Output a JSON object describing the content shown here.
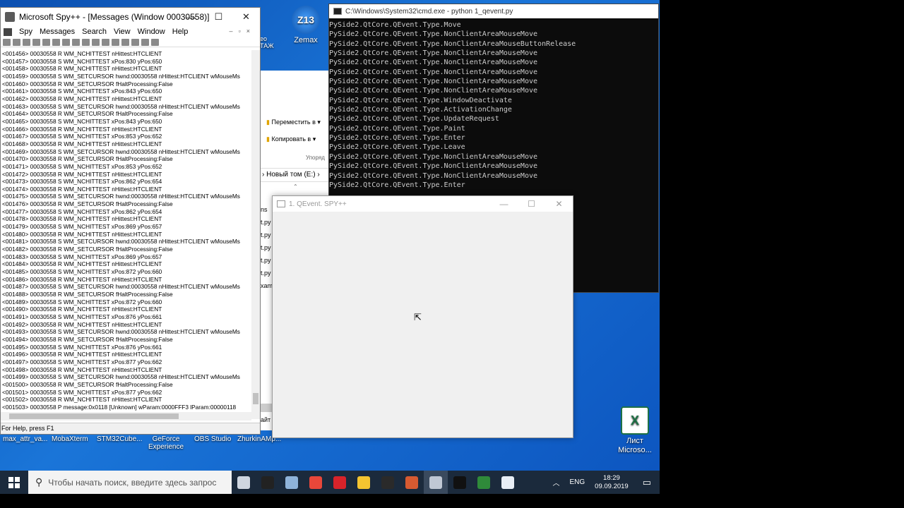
{
  "desktop": {
    "icons": [
      {
        "label": "Zemax",
        "badge": "Z13"
      },
      {
        "label": "Лист\nMicroso...",
        "badge": "X"
      }
    ],
    "bottom_icons": [
      "max_attr_va...",
      "MobaXterm",
      "STM32Cube...",
      "GeForce\nExperience",
      "OBS Studio",
      "ZhurkinAMp..."
    ],
    "left_partial_labels": [
      "eo",
      "ТАЖ"
    ]
  },
  "spy": {
    "title": "Microsoft Spy++ - [Messages (Window 00030558)]",
    "menu": [
      "Spy",
      "Messages",
      "Search",
      "View",
      "Window",
      "Help"
    ],
    "status": "For Help, press F1",
    "log": [
      "<001456> 00030558 R WM_NCHITTEST nHittest:HTCLIENT",
      "<001457> 00030558 S WM_NCHITTEST xPos:830 yPos:650",
      "<001458> 00030558 R WM_NCHITTEST nHittest:HTCLIENT",
      "<001459> 00030558 S WM_SETCURSOR hwnd:00030558 nHittest:HTCLIENT wMouseMs",
      "<001460> 00030558 R WM_SETCURSOR fHaltProcessing:False",
      "<001461> 00030558 S WM_NCHITTEST xPos:843 yPos:650",
      "<001462> 00030558 R WM_NCHITTEST nHittest:HTCLIENT",
      "<001463> 00030558 S WM_SETCURSOR hwnd:00030558 nHittest:HTCLIENT wMouseMs",
      "<001464> 00030558 R WM_SETCURSOR fHaltProcessing:False",
      "<001465> 00030558 S WM_NCHITTEST xPos:843 yPos:650",
      "<001466> 00030558 R WM_NCHITTEST nHittest:HTCLIENT",
      "<001467> 00030558 S WM_NCHITTEST xPos:853 yPos:652",
      "<001468> 00030558 R WM_NCHITTEST nHittest:HTCLIENT",
      "<001469> 00030558 S WM_SETCURSOR hwnd:00030558 nHittest:HTCLIENT wMouseMs",
      "<001470> 00030558 R WM_SETCURSOR fHaltProcessing:False",
      "<001471> 00030558 S WM_NCHITTEST xPos:853 yPos:652",
      "<001472> 00030558 R WM_NCHITTEST nHittest:HTCLIENT",
      "<001473> 00030558 S WM_NCHITTEST xPos:862 yPos:654",
      "<001474> 00030558 R WM_NCHITTEST nHittest:HTCLIENT",
      "<001475> 00030558 S WM_SETCURSOR hwnd:00030558 nHittest:HTCLIENT wMouseMs",
      "<001476> 00030558 R WM_SETCURSOR fHaltProcessing:False",
      "<001477> 00030558 S WM_NCHITTEST xPos:862 yPos:654",
      "<001478> 00030558 R WM_NCHITTEST nHittest:HTCLIENT",
      "<001479> 00030558 S WM_NCHITTEST xPos:869 yPos:657",
      "<001480> 00030558 R WM_NCHITTEST nHittest:HTCLIENT",
      "<001481> 00030558 S WM_SETCURSOR hwnd:00030558 nHittest:HTCLIENT wMouseMs",
      "<001482> 00030558 R WM_SETCURSOR fHaltProcessing:False",
      "<001483> 00030558 S WM_NCHITTEST xPos:869 yPos:657",
      "<001484> 00030558 R WM_NCHITTEST nHittest:HTCLIENT",
      "<001485> 00030558 S WM_NCHITTEST xPos:872 yPos:660",
      "<001486> 00030558 R WM_NCHITTEST nHittest:HTCLIENT",
      "<001487> 00030558 S WM_SETCURSOR hwnd:00030558 nHittest:HTCLIENT wMouseMs",
      "<001488> 00030558 R WM_SETCURSOR fHaltProcessing:False",
      "<001489> 00030558 S WM_NCHITTEST xPos:872 yPos:660",
      "<001490> 00030558 R WM_NCHITTEST nHittest:HTCLIENT",
      "<001491> 00030558 S WM_NCHITTEST xPos:876 yPos:661",
      "<001492> 00030558 R WM_NCHITTEST nHittest:HTCLIENT",
      "<001493> 00030558 S WM_SETCURSOR hwnd:00030558 nHittest:HTCLIENT wMouseMs",
      "<001494> 00030558 R WM_SETCURSOR fHaltProcessing:False",
      "<001495> 00030558 S WM_NCHITTEST xPos:876 yPos:661",
      "<001496> 00030558 R WM_NCHITTEST nHittest:HTCLIENT",
      "<001497> 00030558 S WM_NCHITTEST xPos:877 yPos:662",
      "<001498> 00030558 R WM_NCHITTEST nHittest:HTCLIENT",
      "<001499> 00030558 S WM_SETCURSOR hwnd:00030558 nHittest:HTCLIENT wMouseMs",
      "<001500> 00030558 R WM_SETCURSOR fHaltProcessing:False",
      "<001501> 00030558 S WM_NCHITTEST xPos:877 yPos:662",
      "<001502> 00030558 R WM_NCHITTEST nHittest:HTCLIENT",
      "<001503> 00030558 P message:0x0118 [Unknown] wParam:0000FFF3 lParam:00000118"
    ]
  },
  "explorer": {
    "move_label": "Переместить в",
    "copy_label": "Копировать в",
    "organize_label": "Упоряд",
    "breadcrumb": "Новый том (E:)",
    "file_fragments": [
      "ns",
      "t.py",
      "t.py",
      "t.py",
      "t.py",
      "t.py",
      "xam"
    ],
    "footer": "айт"
  },
  "cmd": {
    "title": "C:\\Windows\\System32\\cmd.exe - python  1_qevent.py",
    "lines": [
      "PySide2.QtCore.QEvent.Type.Move",
      "PySide2.QtCore.QEvent.Type.NonClientAreaMouseMove",
      "PySide2.QtCore.QEvent.Type.NonClientAreaMouseButtonRelease",
      "PySide2.QtCore.QEvent.Type.NonClientAreaMouseMove",
      "PySide2.QtCore.QEvent.Type.NonClientAreaMouseMove",
      "PySide2.QtCore.QEvent.Type.NonClientAreaMouseMove",
      "PySide2.QtCore.QEvent.Type.NonClientAreaMouseMove",
      "PySide2.QtCore.QEvent.Type.NonClientAreaMouseMove",
      "PySide2.QtCore.QEvent.Type.WindowDeactivate",
      "PySide2.QtCore.QEvent.Type.ActivationChange",
      "PySide2.QtCore.QEvent.Type.UpdateRequest",
      "PySide2.QtCore.QEvent.Type.Paint",
      "PySide2.QtCore.QEvent.Type.Enter",
      "PySide2.QtCore.QEvent.Type.Leave",
      "PySide2.QtCore.QEvent.Type.NonClientAreaMouseMove",
      "PySide2.QtCore.QEvent.Type.NonClientAreaMouseMove",
      "PySide2.QtCore.QEvent.Type.NonClientAreaMouseMove",
      "PySide2.QtCore.QEvent.Type.Enter"
    ]
  },
  "qwin": {
    "title": "1. QEvent. SPY++"
  },
  "taskbar": {
    "search_placeholder": "Чтобы начать поиск, введите здесь запрос",
    "language": "ENG",
    "time": "18:29",
    "date": "09.09.2019",
    "app_colors": [
      "#cfd6e0",
      "#222222",
      "#8fb3d9",
      "#e8473a",
      "#d8232a",
      "#f4c430",
      "#2a2a2a",
      "#d65a31",
      "#c0c8d4",
      "#111111",
      "#2f8a3a",
      "#e8eef5"
    ]
  },
  "colors": {
    "desktop": "#1a6fd4",
    "console_bg": "#0c0c0c",
    "console_fg": "#cccccc",
    "taskbar": "#1b2a3c"
  }
}
